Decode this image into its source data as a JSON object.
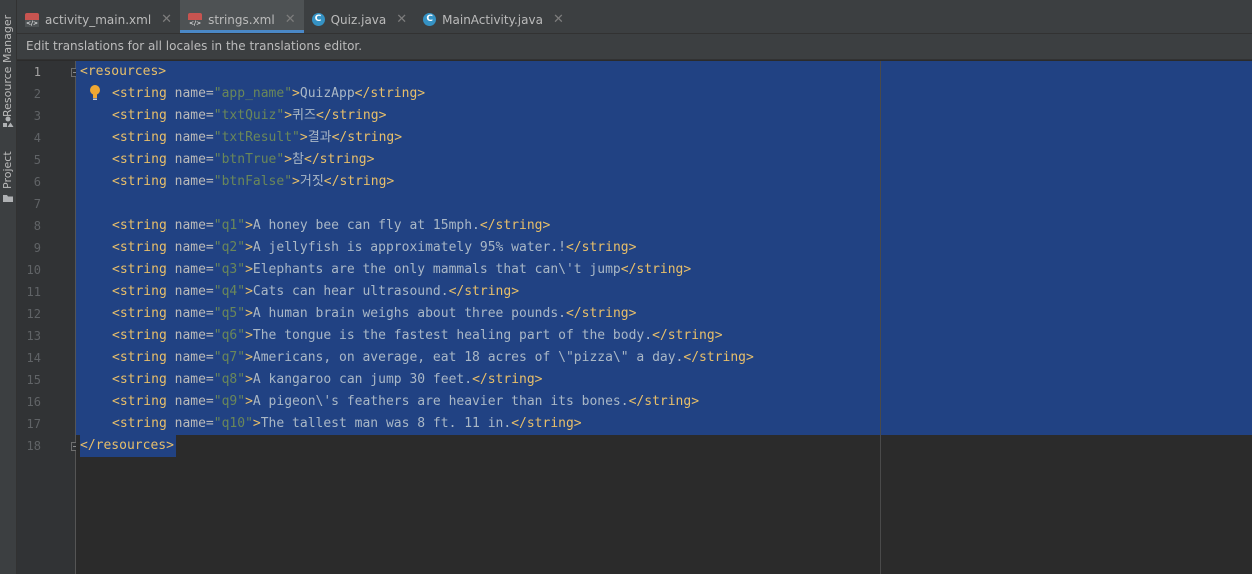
{
  "sidebar": {
    "resource_manager": "Resource Manager",
    "project": "Project"
  },
  "tabs": [
    {
      "label": "activity_main.xml",
      "icon": "xml-file-icon",
      "active": false
    },
    {
      "label": "strings.xml",
      "icon": "xml-file-icon",
      "active": true
    },
    {
      "label": "Quiz.java",
      "icon": "java-class-icon",
      "active": false
    },
    {
      "label": "MainActivity.java",
      "icon": "java-class-icon",
      "active": false
    }
  ],
  "notice": "Edit translations for all locales in the translations editor.",
  "line_numbers": [
    "1",
    "2",
    "3",
    "4",
    "5",
    "6",
    "7",
    "8",
    "9",
    "10",
    "11",
    "12",
    "13",
    "14",
    "15",
    "16",
    "17",
    "18"
  ],
  "code": {
    "open": "<resources>",
    "close": "</resources>",
    "strings": [
      {
        "name": "app_name",
        "text": "QuizApp"
      },
      {
        "name": "txtQuiz",
        "text": "퀴즈"
      },
      {
        "name": "txtResult",
        "text": "결과"
      },
      {
        "name": "btnTrue",
        "text": "참"
      },
      {
        "name": "btnFalse",
        "text": "거짓"
      },
      {
        "name": "q1",
        "text": "A honey bee can fly at 15mph."
      },
      {
        "name": "q2",
        "text": "A jellyfish is approximately 95% water.!"
      },
      {
        "name": "q3",
        "text": "Elephants are the only mammals that can\\'t jump"
      },
      {
        "name": "q4",
        "text": "Cats can hear ultrasound."
      },
      {
        "name": "q5",
        "text": "A human brain weighs about three pounds."
      },
      {
        "name": "q6",
        "text": "The tongue is the fastest healing part of the body."
      },
      {
        "name": "q7",
        "text": "Americans, on average, eat 18 acres of \\\"pizza\\\" a day."
      },
      {
        "name": "q8",
        "text": "A kangaroo can jump 30 feet."
      },
      {
        "name": "q9",
        "text": "A pigeon\\'s feathers are heavier than its bones."
      },
      {
        "name": "q10",
        "text": "The tallest man was 8 ft. 11 in."
      }
    ]
  },
  "colors": {
    "selection": "#214283",
    "tag": "#e8bf6a",
    "attribute_value": "#6a8759",
    "text": "#a9b7c6",
    "active_tab_underline": "#4a88c7"
  }
}
